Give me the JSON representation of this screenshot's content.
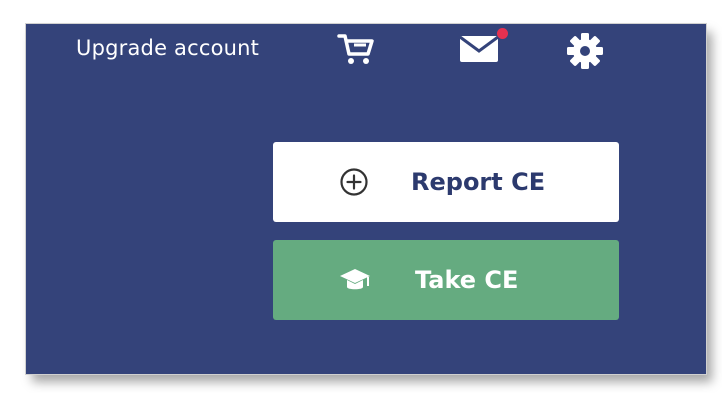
{
  "header": {
    "upgrade_label": "Upgrade account",
    "notification_color": "#e53150"
  },
  "icons": {
    "cart": "cart-icon",
    "mail": "mail-icon",
    "settings": "gear-icon",
    "report": "plus-circle-icon",
    "take": "graduation-cap-icon"
  },
  "actions": {
    "report_label": "Report CE",
    "take_label": "Take CE"
  },
  "colors": {
    "background": "#34437a",
    "report_text": "#2c3a6e",
    "take_button": "#65ab80"
  }
}
